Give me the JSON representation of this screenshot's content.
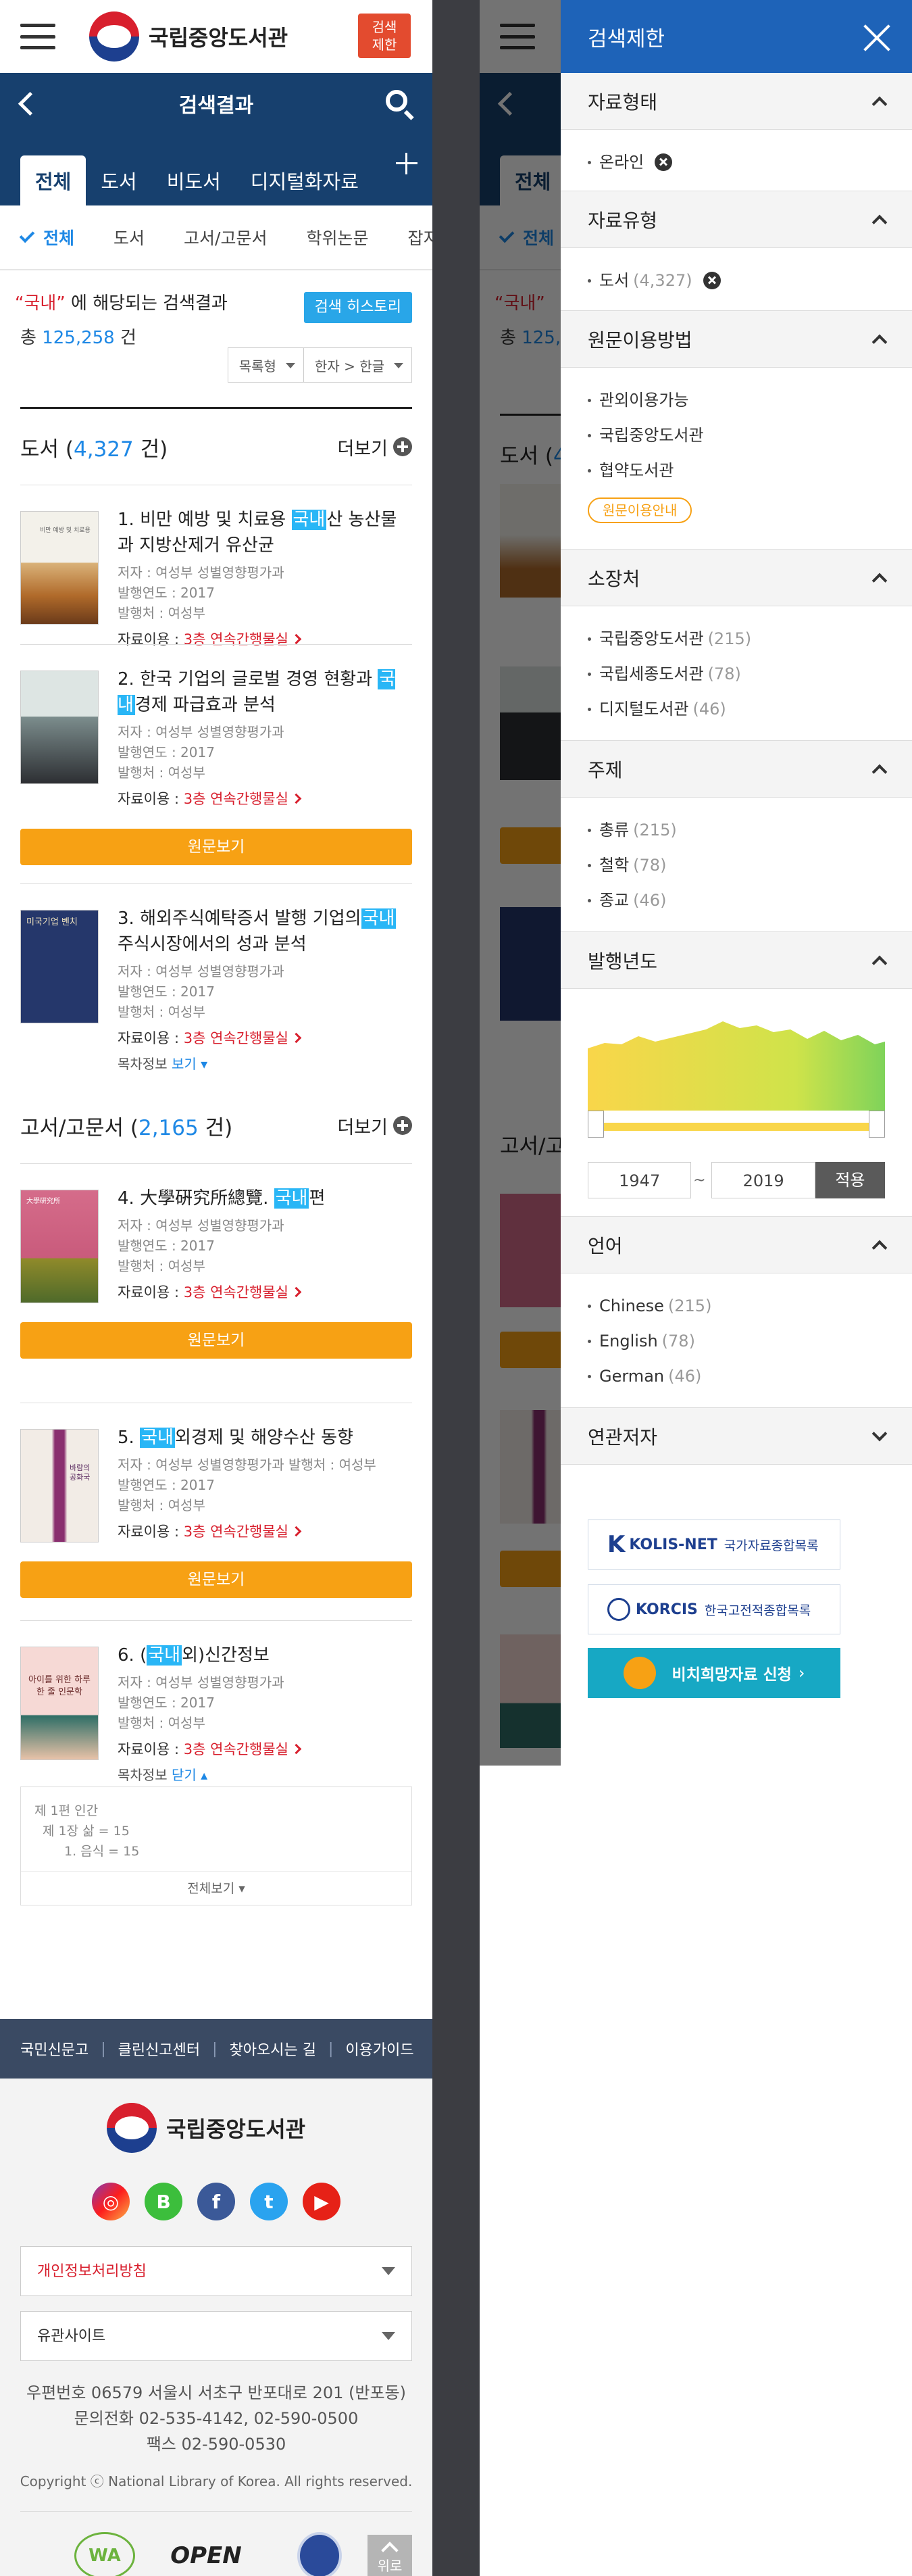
{
  "header": {
    "logo_text": "국립중앙도서관",
    "search_limit_line1": "검색",
    "search_limit_line2": "제한"
  },
  "title_bar": {
    "title": "검색결과"
  },
  "tabs": [
    {
      "label": "전체"
    },
    {
      "label": "도서"
    },
    {
      "label": "비도서"
    },
    {
      "label": "디지털화자료"
    }
  ],
  "subtabs": [
    {
      "label": "전체"
    },
    {
      "label": "도서"
    },
    {
      "label": "고서/고문서"
    },
    {
      "label": "학위논문"
    },
    {
      "label": "잡지/"
    }
  ],
  "summary": {
    "query": "“국내”",
    "line1_suffix": " 에 해당되는 검색결과",
    "total_prefix": "총 ",
    "total": "125,258",
    "total_suffix": " 건",
    "history_button": "검색 히스토리"
  },
  "sort": {
    "list_type": "목록형",
    "conversion": "한자 > 한글"
  },
  "sections": {
    "books": {
      "label": "도서 (",
      "count": "4,327",
      "suffix": " 건)",
      "more": "더보기"
    },
    "oldbooks": {
      "label": "고서/고문서 (",
      "count": "2,165",
      "suffix": " 건)",
      "more": "더보기"
    }
  },
  "items": [
    {
      "pre": "1. 비만 예방 및 치료용 ",
      "hl": "국내",
      "post": "산 농산물과 지방산제거 유산균",
      "author": "저자 : 여성부 성별영향평가과",
      "year": "발행연도 : 2017",
      "publisher": "발행처 : 여성부",
      "use_label": "자료이용 : ",
      "use_link": "3층 연속간행물실"
    },
    {
      "pre": "2. 한국 기업의 글로벌 경영 현황과 ",
      "hl": "국내",
      "post": "경제 파급효과 분석",
      "author": "저자 : 여성부 성별영향평가과",
      "year": "발행연도 : 2017",
      "publisher": "발행처 : 여성부",
      "use_label": "자료이용 : ",
      "use_link": "3층 연속간행물실",
      "button": "원문보기"
    },
    {
      "pre": "3. 해외주식예탁증서 발행 기업의",
      "hl": "국내",
      "post": "주식시장에서의 성과 분석",
      "author": "저자 : 여성부 성별영향평가과",
      "year": "발행연도 : 2017",
      "publisher": "발행처 : 여성부",
      "use_label": "자료이용 : ",
      "use_link": "3층 연속간행물실",
      "toc_label": "목차정보 ",
      "toc_link": "보기"
    },
    {
      "pre": "4. 大學硏究所總覽. ",
      "hl": "국내",
      "post": "편",
      "author": "저자 : 여성부 성별영향평가과",
      "year": "발행연도 : 2017",
      "publisher": "발행처 : 여성부",
      "use_label": "자료이용 : ",
      "use_link": "3층 연속간행물실",
      "button": "원문보기"
    },
    {
      "pre": "5. ",
      "hl": "국내",
      "post": "외경제 및 해양수산 동향",
      "author": "저자 : 여성부 성별영향평가과    발행처 : 여성부",
      "year": "발행연도 : 2017",
      "publisher": "발행처 : 여성부",
      "use_label": "자료이용 : ",
      "use_link": "3층 연속간행물실",
      "button": "원문보기"
    },
    {
      "pre": "6. (",
      "hl": "국내",
      "post": "외)신간정보",
      "author": "저자 : 여성부 성별영향평가과",
      "year": "발행연도 : 2017",
      "publisher": "발행처 : 여성부",
      "use_label": "자료이용 : ",
      "use_link": "3층 연속간행물실",
      "toc_label": "목차정보 ",
      "toc_link": "닫기"
    }
  ],
  "toc_box": {
    "l1": "제 1편 인간",
    "l2": "제 1장 삶 = 15",
    "l3": "1. 음식 = 15",
    "all": "전체보기"
  },
  "thumb_text": {
    "b1": "비만 예방 및 치료용",
    "b3": "미국기업 벤치",
    "b4": "大學硏究所",
    "b5": "바람의 공화국",
    "b6": "아이를 위한 하루 한 줄 인문학"
  },
  "footer": {
    "nav": [
      "국민신문고",
      "클린신고센터",
      "찾아오시는 길",
      "이용가이드"
    ],
    "logo_text": "국립중앙도서관",
    "privacy": "개인정보처리방침",
    "related": "유관사이트",
    "addr1": "우편번호 06579 서울시 서초구 반포대로 201 (반포동)",
    "addr2": "문의전화 02-535-4142, 02-590-0500",
    "addr3": "팩스 02-590-0530",
    "copyright": "Copyright ⓒ National Library of Korea. All rights reserved.",
    "top": "위로",
    "wa": "WA",
    "open": "OPEN"
  },
  "drawer": {
    "title": "검색제한",
    "form": {
      "head": "자료형태",
      "items": [
        {
          "label": "온라인"
        }
      ]
    },
    "type": {
      "head": "자료유형",
      "items": [
        {
          "label": "도서",
          "count": "(4,327)"
        }
      ]
    },
    "access": {
      "head": "원문이용방법",
      "items": [
        {
          "label": "관외이용가능"
        },
        {
          "label": "국립중앙도서관"
        },
        {
          "label": "협약도서관"
        }
      ],
      "guide": "원문이용안내"
    },
    "holding": {
      "head": "소장처",
      "items": [
        {
          "label": "국립중앙도서관",
          "count": "(215)"
        },
        {
          "label": "국립세종도서관",
          "count": "(78)"
        },
        {
          "label": "디지털도서관",
          "count": "(46)"
        }
      ]
    },
    "subject": {
      "head": "주제",
      "items": [
        {
          "label": "총류",
          "count": "(215)"
        },
        {
          "label": "철학",
          "count": "(78)"
        },
        {
          "label": "종교",
          "count": "(46)"
        }
      ]
    },
    "year": {
      "head": "발행년도",
      "from": "1947",
      "to": "2019",
      "apply": "적용"
    },
    "lang": {
      "head": "언어",
      "items": [
        {
          "label": "Chinese",
          "count": "(215)"
        },
        {
          "label": "English",
          "count": "(78)"
        },
        {
          "label": "German",
          "count": "(46)"
        }
      ]
    },
    "author": {
      "head": "연관저자"
    },
    "links": {
      "kolis": "KOLIS-NET",
      "kolis_sub": "국가자료종합목록",
      "korcis": "KORCIS",
      "korcis_sub": "한국고전적종합목록",
      "hope": "비치희망자료 신청"
    }
  },
  "colors": {
    "navy": "#17406e",
    "accent": "#1e88e5",
    "orange": "#f7a114",
    "red": "#d81f2d",
    "highlight": "#29b6f6",
    "drawer_blue": "#1e63b8"
  }
}
